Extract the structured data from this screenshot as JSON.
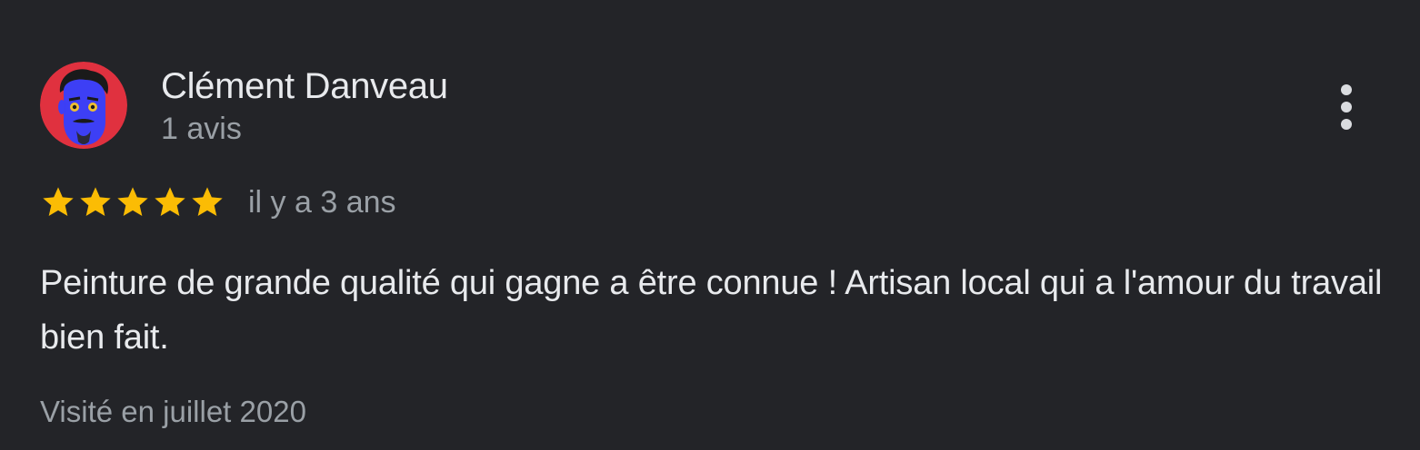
{
  "review": {
    "author": {
      "name": "Clément Danveau",
      "meta": "1 avis",
      "avatar_icon": "cartoon-face-avatar"
    },
    "rating": {
      "value": 5,
      "max": 5,
      "star_color": "#fbbc04"
    },
    "relative_date": "il y a 3 ans",
    "text": "Peinture de grande qualité qui gagne a être connue ! Artisan local qui a l'amour du travail bien fait.",
    "visit_date": "Visité en juillet 2020",
    "more_icon": "more-vert-icon"
  },
  "colors": {
    "background": "#232428",
    "primary_text": "#e8eaed",
    "secondary_text": "#9aa0a6",
    "avatar_bg": "#e0313f",
    "avatar_face": "#3d3ff5"
  }
}
